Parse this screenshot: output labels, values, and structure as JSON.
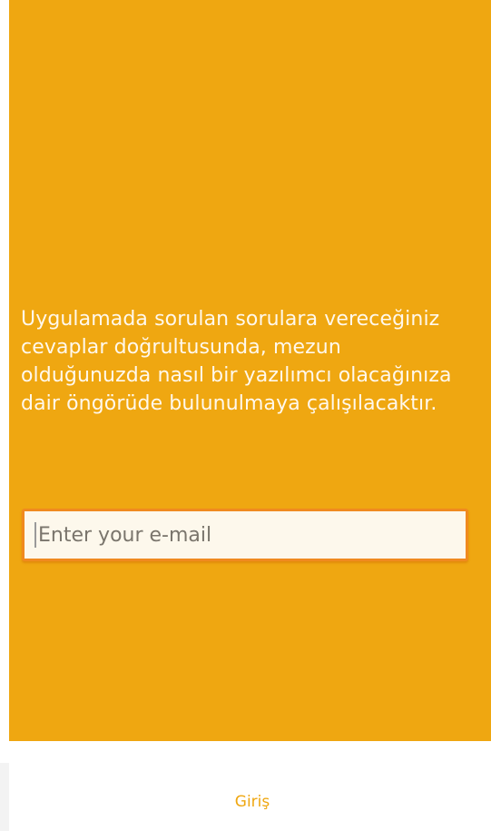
{
  "intro": {
    "text": "Uygulamada sorulan sorulara vereceğiniz cevaplar doğrultusunda, mezun olduğunuzda nasıl bir yazılımcı olacağınıza dair öngörüde bulunulmaya çalışılacaktır."
  },
  "email": {
    "placeholder": "Enter your e-mail",
    "value": ""
  },
  "login": {
    "label": "Giriş"
  },
  "colors": {
    "panel": "#EFA711",
    "input_border": "#F08A1F",
    "text_light": "#FFF8EC",
    "button_text": "#EFA711"
  }
}
